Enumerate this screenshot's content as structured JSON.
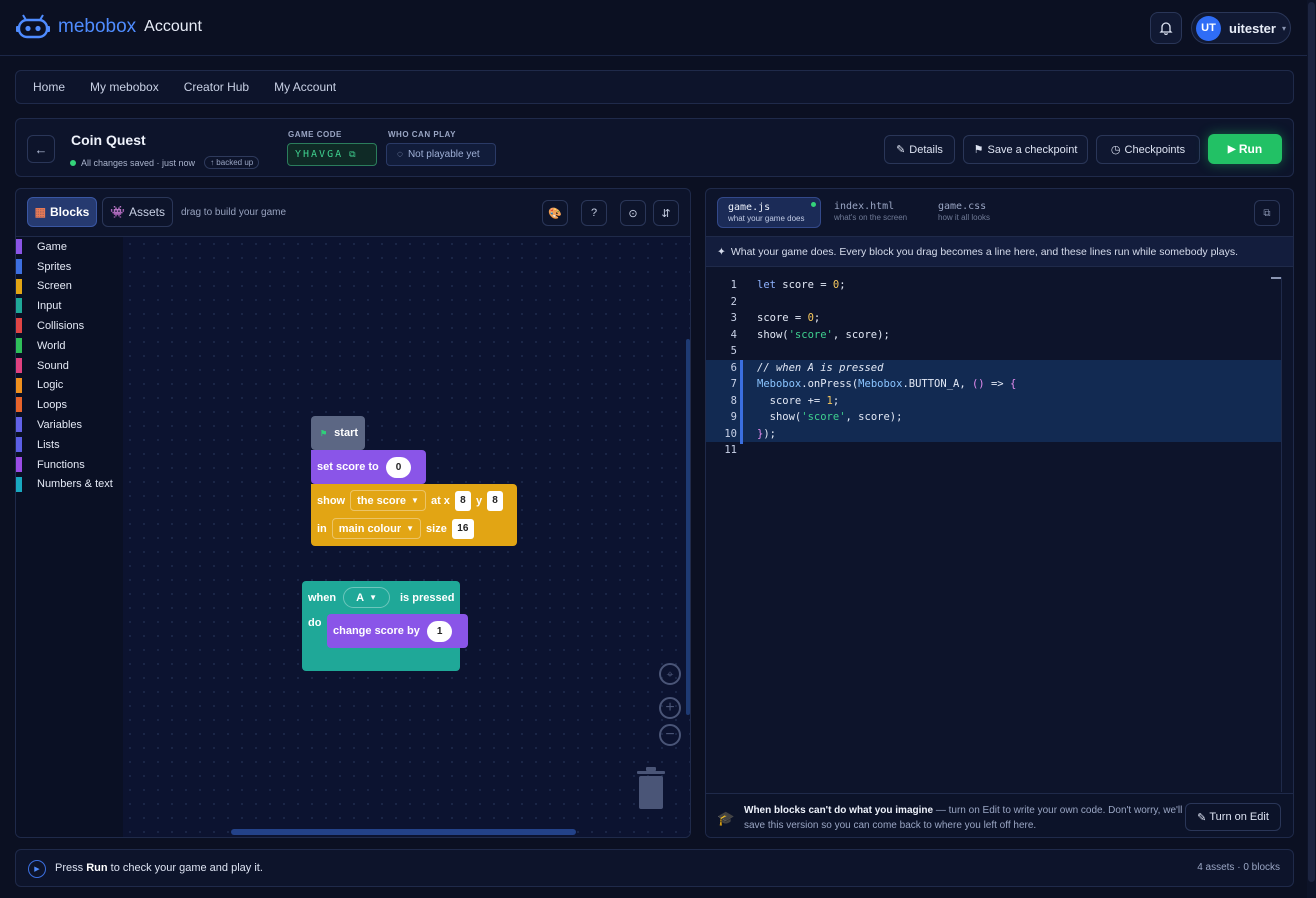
{
  "brand": {
    "name": "mebobox",
    "sub": "Account"
  },
  "user": {
    "initials": "UT",
    "name": "uitester"
  },
  "nav": [
    "Home",
    "My mebobox",
    "Creator Hub",
    "My Account"
  ],
  "game": {
    "title": "Coin Quest",
    "saved": "All changes saved · just now",
    "backed": "backed up",
    "code_label": "GAME CODE",
    "code": "YHAVGA",
    "who_label": "WHO CAN PLAY",
    "who": "Not playable yet",
    "details": "Details",
    "checkpoint": "Save a checkpoint",
    "checkpoints": "Checkpoints",
    "run": "Run"
  },
  "blocks_panel": {
    "tab_blocks": "Blocks",
    "tab_assets": "Assets",
    "hint": "drag to build your game",
    "help": "?",
    "categories": [
      {
        "name": "Game",
        "color": "#8b55e6"
      },
      {
        "name": "Sprites",
        "color": "#3d6fe0"
      },
      {
        "name": "Screen",
        "color": "#e2a514"
      },
      {
        "name": "Input",
        "color": "#1fa898"
      },
      {
        "name": "Collisions",
        "color": "#e04545"
      },
      {
        "name": "World",
        "color": "#2fbf5a"
      },
      {
        "name": "Sound",
        "color": "#e0417f"
      },
      {
        "name": "Logic",
        "color": "#f0901e"
      },
      {
        "name": "Loops",
        "color": "#e8642b"
      },
      {
        "name": "Variables",
        "color": "#6262e8"
      },
      {
        "name": "Lists",
        "color": "#5c5fe6"
      },
      {
        "name": "Functions",
        "color": "#9a4ce6"
      },
      {
        "name": "Numbers & text",
        "color": "#19a8c0"
      }
    ],
    "workspace": {
      "start": "start",
      "set_score": "set score to",
      "set_value": "0",
      "show": "show",
      "the_score": "the score",
      "at_x": "at x",
      "x_val": "8",
      "y": "y",
      "y_val": "8",
      "in": "in",
      "main_colour": "main colour",
      "size": "size",
      "size_val": "16",
      "when": "when",
      "key": "A",
      "is_pressed": "is pressed",
      "do": "do",
      "change_score": "change score by",
      "change_val": "1"
    }
  },
  "code_panel": {
    "files": [
      {
        "name": "game.js",
        "desc": "what your game does"
      },
      {
        "name": "index.html",
        "desc": "what's on the screen"
      },
      {
        "name": "game.css",
        "desc": "how it all looks"
      }
    ],
    "info": "What your game does. Every block you drag becomes a line here, and these lines run while somebody plays.",
    "line_numbers": [
      "1",
      "2",
      "3",
      "4",
      "5",
      "6",
      "7",
      "8",
      "9",
      "10",
      "11"
    ],
    "code": {
      "l1_kw": "let",
      "l1_a": " score = ",
      "l1_n": "0",
      "l1_b": ";",
      "l3_a": "score = ",
      "l3_n": "0",
      "l3_b": ";",
      "l4_a": "show(",
      "l4_s": "'score'",
      "l4_b": ", score);",
      "l6": "// when A is pressed",
      "l7_o": "Mebobox",
      "l7_a": ".onPress(",
      "l7_o2": "Mebobox",
      "l7_b": ".BUTTON_A, ",
      "l7_p": "()",
      "l7_c": " => ",
      "l7_br": "{",
      "l8_a": "  score += ",
      "l8_n": "1",
      "l8_b": ";",
      "l9_a": "  show(",
      "l9_s": "'score'",
      "l9_b": ", score);",
      "l10_br": "}",
      "l10_b": ");"
    },
    "foot_bold": "When blocks can't do what you imagine",
    "foot_rest": " — turn on Edit to write your own code. Don't worry, we'll save this version so you can come back to where you left off here.",
    "edit_btn": "Turn on Edit"
  },
  "status": {
    "pre": "Press ",
    "run": "Run",
    "post": " to check your game and play it.",
    "count": "4 assets · 0 blocks"
  }
}
